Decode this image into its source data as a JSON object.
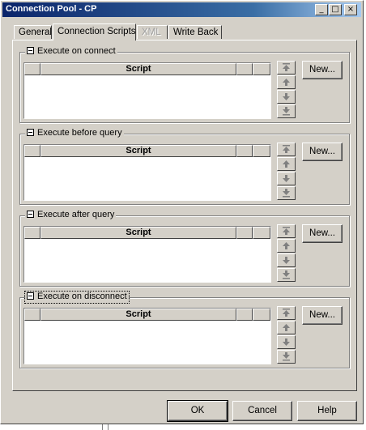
{
  "window": {
    "title": "Connection Pool - CP"
  },
  "title_buttons": {
    "minimize": "_",
    "maximize": "□",
    "close": "×"
  },
  "tabs": [
    {
      "label": "General",
      "state": "normal"
    },
    {
      "label": "Connection Scripts",
      "state": "active"
    },
    {
      "label": "XML",
      "state": "disabled"
    },
    {
      "label": "Write Back",
      "state": "normal"
    }
  ],
  "groups": [
    {
      "label": "Execute on connect",
      "column_header": "Script",
      "new_label": "New..."
    },
    {
      "label": "Execute before query",
      "column_header": "Script",
      "new_label": "New..."
    },
    {
      "label": "Execute after query",
      "column_header": "Script",
      "new_label": "New..."
    },
    {
      "label": "Execute on disconnect",
      "column_header": "Script",
      "new_label": "New..."
    }
  ],
  "buttons": {
    "ok": "OK",
    "cancel": "Cancel",
    "help": "Help"
  },
  "colors": {
    "face": "#d4d0c8",
    "title_start": "#0a246a",
    "title_end": "#a6caf0"
  }
}
